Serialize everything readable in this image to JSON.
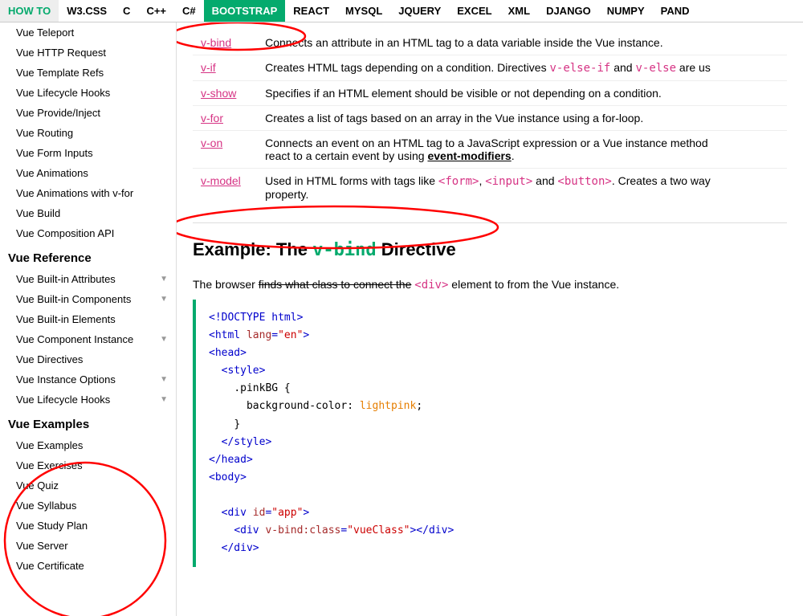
{
  "nav": {
    "items": [
      {
        "label": "HOW TO",
        "class": "howto",
        "active": false
      },
      {
        "label": "W3.CSS",
        "class": "",
        "active": false
      },
      {
        "label": "C",
        "class": "",
        "active": false
      },
      {
        "label": "C++",
        "class": "",
        "active": false
      },
      {
        "label": "C#",
        "class": "",
        "active": false
      },
      {
        "label": "BOOTSTRAP",
        "class": "",
        "active": true
      },
      {
        "label": "REACT",
        "class": "",
        "active": false
      },
      {
        "label": "MYSQL",
        "class": "",
        "active": false
      },
      {
        "label": "JQUERY",
        "class": "",
        "active": false
      },
      {
        "label": "EXCEL",
        "class": "",
        "active": false
      },
      {
        "label": "XML",
        "class": "",
        "active": false
      },
      {
        "label": "DJANGO",
        "class": "",
        "active": false
      },
      {
        "label": "NUMPY",
        "class": "",
        "active": false
      },
      {
        "label": "PAND",
        "class": "",
        "active": false
      }
    ]
  },
  "sidebar": {
    "top_items": [
      {
        "label": "Vue Teleport"
      },
      {
        "label": "Vue HTTP Request"
      },
      {
        "label": "Vue Template Refs"
      },
      {
        "label": "Vue Lifecycle Hooks"
      },
      {
        "label": "Vue Provide/Inject"
      },
      {
        "label": "Vue Routing"
      },
      {
        "label": "Vue Form Inputs"
      },
      {
        "label": "Vue Animations"
      },
      {
        "label": "Vue Animations with v-for"
      },
      {
        "label": "Vue Build"
      },
      {
        "label": "Vue Composition API"
      }
    ],
    "reference_title": "Vue Reference",
    "reference_items": [
      {
        "label": "Vue Built-in Attributes",
        "has_arrow": true
      },
      {
        "label": "Vue Built-in Components",
        "has_arrow": true
      },
      {
        "label": "Vue Built-in Elements",
        "has_arrow": false
      },
      {
        "label": "Vue Component Instance",
        "has_arrow": true
      },
      {
        "label": "Vue Directives",
        "has_arrow": false
      },
      {
        "label": "Vue Instance Options",
        "has_arrow": true
      },
      {
        "label": "Vue Lifecycle Hooks",
        "has_arrow": true
      }
    ],
    "examples_title": "Vue Examples",
    "examples_items": [
      {
        "label": "Vue Examples"
      },
      {
        "label": "Vue Exercises"
      },
      {
        "label": "Vue Quiz"
      },
      {
        "label": "Vue Syllabus"
      },
      {
        "label": "Vue Study Plan"
      },
      {
        "label": "Vue Server"
      },
      {
        "label": "Vue Certificate"
      }
    ]
  },
  "directives": [
    {
      "link": "v-bind",
      "desc": "Connects an attribute in an HTML tag to a data variable inside the Vue instance."
    },
    {
      "link": "v-if",
      "desc_parts": [
        {
          "text": "Creates HTML tags depending on a condition. Directives "
        },
        {
          "text": "v-else-if",
          "class": "code-inline"
        },
        {
          "text": " and "
        },
        {
          "text": "v-else",
          "class": "code-inline"
        },
        {
          "text": " are us"
        }
      ]
    },
    {
      "link": "v-show",
      "desc": "Specifies if an HTML element should be visible or not depending on a condition."
    },
    {
      "link": "v-for",
      "desc": "Creates a list of tags based on an array in the Vue instance using a for-loop."
    },
    {
      "link": "v-on",
      "desc_parts": [
        {
          "text": "Connects an event on an HTML tag to a JavaScript expression or a Vue instance method"
        },
        {
          "text": "\nreact to a certain event by using "
        },
        {
          "text": "event-modifiers",
          "class": "bold-underline"
        },
        {
          "text": "."
        }
      ]
    },
    {
      "link": "v-model",
      "desc_parts": [
        {
          "text": "Used in HTML forms with tags like "
        },
        {
          "text": "<form>",
          "class": "code-inline"
        },
        {
          "text": ", "
        },
        {
          "text": "<input>",
          "class": "code-inline"
        },
        {
          "text": " and "
        },
        {
          "text": "<button>",
          "class": "code-inline"
        },
        {
          "text": ". Creates a two way"
        },
        {
          "text": "\nproperty."
        }
      ]
    }
  ],
  "example": {
    "heading_prefix": "Example: The ",
    "heading_vbind": "v-bind",
    "heading_suffix": " Directive",
    "desc_prefix": "The browser ",
    "desc_strikethrough": "finds what class to connect the",
    "desc_code": "<div>",
    "desc_suffix": " element to from the Vue instance."
  },
  "code_block": {
    "lines": [
      {
        "parts": [
          {
            "text": "<!DOCTYPE html>",
            "class": "cb-blue"
          }
        ]
      },
      {
        "parts": [
          {
            "text": "<html ",
            "class": "cb-blue"
          },
          {
            "text": "lang",
            "class": "cb-brown"
          },
          {
            "text": "=",
            "class": "cb-black"
          },
          {
            "text": "\"en\"",
            "class": "cb-red"
          },
          {
            "text": ">",
            "class": "cb-blue"
          }
        ]
      },
      {
        "parts": [
          {
            "text": "<head>",
            "class": "cb-blue"
          }
        ]
      },
      {
        "parts": [
          {
            "text": "  <style>",
            "class": "cb-blue"
          }
        ]
      },
      {
        "parts": [
          {
            "text": "    .pinkBG {",
            "class": "cb-black"
          }
        ]
      },
      {
        "parts": [
          {
            "text": "      background-color: ",
            "class": "cb-black"
          },
          {
            "text": "lightpink",
            "class": "cb-orange"
          },
          {
            "text": ";",
            "class": "cb-black"
          }
        ]
      },
      {
        "parts": [
          {
            "text": "    }",
            "class": "cb-black"
          }
        ]
      },
      {
        "parts": [
          {
            "text": "  </style>",
            "class": "cb-blue"
          }
        ]
      },
      {
        "parts": [
          {
            "text": "</head>",
            "class": "cb-blue"
          }
        ]
      },
      {
        "parts": [
          {
            "text": "<body>",
            "class": "cb-blue"
          }
        ]
      },
      {
        "parts": [
          {
            "text": ""
          }
        ]
      },
      {
        "parts": [
          {
            "text": "  <div ",
            "class": "cb-blue"
          },
          {
            "text": "id",
            "class": "cb-brown"
          },
          {
            "text": "=",
            "class": "cb-black"
          },
          {
            "text": "\"app\"",
            "class": "cb-red"
          },
          {
            "text": ">",
            "class": "cb-blue"
          }
        ]
      },
      {
        "parts": [
          {
            "text": "    <div ",
            "class": "cb-blue"
          },
          {
            "text": "v-bind:class",
            "class": "cb-brown"
          },
          {
            "text": "=",
            "class": "cb-black"
          },
          {
            "text": "\"vueClass\"",
            "class": "cb-red"
          },
          {
            "text": "></div>",
            "class": "cb-blue"
          }
        ]
      },
      {
        "parts": [
          {
            "text": "  </div>",
            "class": "cb-blue"
          }
        ]
      }
    ]
  }
}
